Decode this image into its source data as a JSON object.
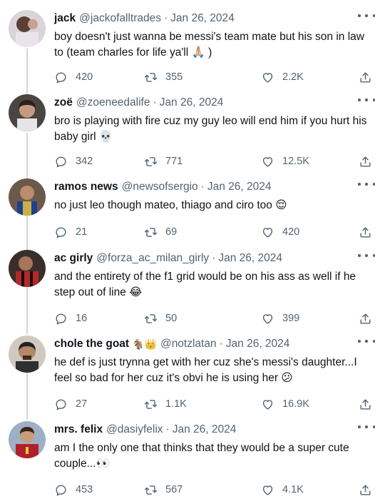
{
  "tweets": [
    {
      "name": "jack",
      "handle": "@jackofalltrades",
      "date": "Jan 26, 2024",
      "badge": "",
      "text": "boy doesn't just wanna be messi's team mate but his son in law to (team charles for life ya'll 🙏🏼 )",
      "replies": "420",
      "retweets": "355",
      "likes": "2.2K"
    },
    {
      "name": "zoë",
      "handle": "@zoeneedalife",
      "date": "Jan 26, 2024",
      "badge": "",
      "text": "bro is playing with fire cuz my guy leo will end him if you hurt his baby girl 💀",
      "replies": "342",
      "retweets": "771",
      "likes": "12.5K"
    },
    {
      "name": "ramos news",
      "handle": "@newsofsergio",
      "date": "Jan 26, 2024",
      "badge": "",
      "text": "no just leo though mateo, thiago and ciro too 😌",
      "replies": "21",
      "retweets": "69",
      "likes": "420"
    },
    {
      "name": "ac girly",
      "handle": "@forza_ac_milan_girly",
      "date": "Jan 26, 2024",
      "badge": "",
      "text": "and the entirety of the f1 grid would be on his ass as well if he step out of line 😂",
      "replies": "16",
      "retweets": "50",
      "likes": "399"
    },
    {
      "name": "chole the goat",
      "handle": "@notzlatan",
      "date": "Jan 26, 2024",
      "badge": "🐐👑",
      "text": "he def is just trynna get with her cuz she's messi's daughter...I feel so bad for her cuz it's obvi he is using her 😕",
      "replies": "27",
      "retweets": "1.1K",
      "likes": "16.9K"
    },
    {
      "name": "mrs. felix",
      "handle": "@dasiyfelix",
      "date": "Jan 26, 2024",
      "badge": "",
      "text": "am I the only one that thinks that they would be a super cute couple...👀",
      "replies": "453",
      "retweets": "567",
      "likes": "4.1K"
    }
  ],
  "separator": "·",
  "icons": {
    "reply": "reply-icon",
    "retweet": "retweet-icon",
    "like": "like-icon",
    "share": "share-icon",
    "more": "more-options-icon"
  },
  "colors": {
    "text": "#0f1419",
    "muted": "#536471",
    "thread_line": "#cfd9de"
  }
}
